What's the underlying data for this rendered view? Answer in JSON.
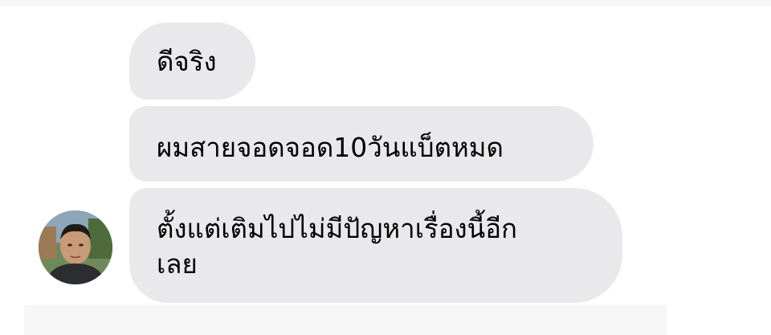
{
  "conversation": {
    "messages": [
      {
        "text": "ดีจริง"
      },
      {
        "text": "ผมสายจอดจอด10วันแบ็ตหมด"
      },
      {
        "lines": [
          "ตั้งแต่เติมไปไม่มีปัญหาเรื่องนี้อีก",
          "เลย"
        ]
      }
    ],
    "sender_avatar": "avatar-photo"
  },
  "colors": {
    "bubble": "#e9e9eb",
    "text": "#000000",
    "background": "#ffffff"
  }
}
